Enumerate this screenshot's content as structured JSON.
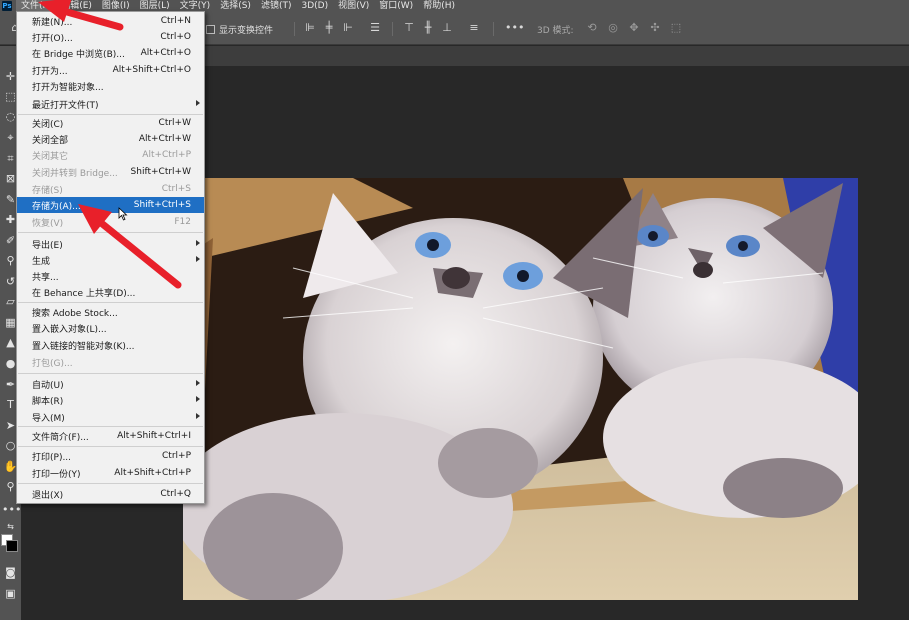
{
  "menubar": {
    "logo": "Ps",
    "items": [
      "文件(F)",
      "编辑(E)",
      "图像(I)",
      "图层(L)",
      "文字(Y)",
      "选择(S)",
      "滤镜(T)",
      "3D(D)",
      "视图(V)",
      "窗口(W)",
      "帮助(H)"
    ]
  },
  "options": {
    "show_transform": "显示变换控件",
    "mode3d": "3D 模式:"
  },
  "file_menu": [
    {
      "label": "新建(N)...",
      "shortcut": "Ctrl+N"
    },
    {
      "label": "打开(O)...",
      "shortcut": "Ctrl+O"
    },
    {
      "label": "在 Bridge 中浏览(B)...",
      "shortcut": "Alt+Ctrl+O"
    },
    {
      "label": "打开为...",
      "shortcut": "Alt+Shift+Ctrl+O"
    },
    {
      "label": "打开为智能对象...",
      "shortcut": ""
    },
    {
      "label": "最近打开文件(T)",
      "shortcut": ""
    },
    {
      "label": "关闭(C)",
      "shortcut": "Ctrl+W"
    },
    {
      "label": "关闭全部",
      "shortcut": "Alt+Ctrl+W"
    },
    {
      "label": "关闭其它",
      "shortcut": "Alt+Ctrl+P"
    },
    {
      "label": "关闭并转到 Bridge...",
      "shortcut": "Shift+Ctrl+W"
    },
    {
      "label": "存储(S)",
      "shortcut": "Ctrl+S"
    },
    {
      "label": "存储为(A)...",
      "shortcut": "Shift+Ctrl+S"
    },
    {
      "label": "恢复(V)",
      "shortcut": "F12"
    },
    {
      "label": "导出(E)",
      "shortcut": ""
    },
    {
      "label": "生成",
      "shortcut": ""
    },
    {
      "label": "共享...",
      "shortcut": ""
    },
    {
      "label": "在 Behance 上共享(D)...",
      "shortcut": ""
    },
    {
      "label": "搜索 Adobe Stock...",
      "shortcut": ""
    },
    {
      "label": "置入嵌入对象(L)...",
      "shortcut": ""
    },
    {
      "label": "置入链接的智能对象(K)...",
      "shortcut": ""
    },
    {
      "label": "打包(G)...",
      "shortcut": ""
    },
    {
      "label": "自动(U)",
      "shortcut": ""
    },
    {
      "label": "脚本(R)",
      "shortcut": ""
    },
    {
      "label": "导入(M)",
      "shortcut": ""
    },
    {
      "label": "文件简介(F)...",
      "shortcut": "Alt+Shift+Ctrl+I"
    },
    {
      "label": "打印(P)...",
      "shortcut": "Ctrl+P"
    },
    {
      "label": "打印一份(Y)",
      "shortcut": "Alt+Shift+Ctrl+P"
    },
    {
      "label": "退出(X)",
      "shortcut": "Ctrl+Q"
    }
  ],
  "colors": {
    "highlight": "#1f6fc4",
    "annotation": "#e8202a",
    "ui_panel": "#535353",
    "workspace": "#282828"
  }
}
